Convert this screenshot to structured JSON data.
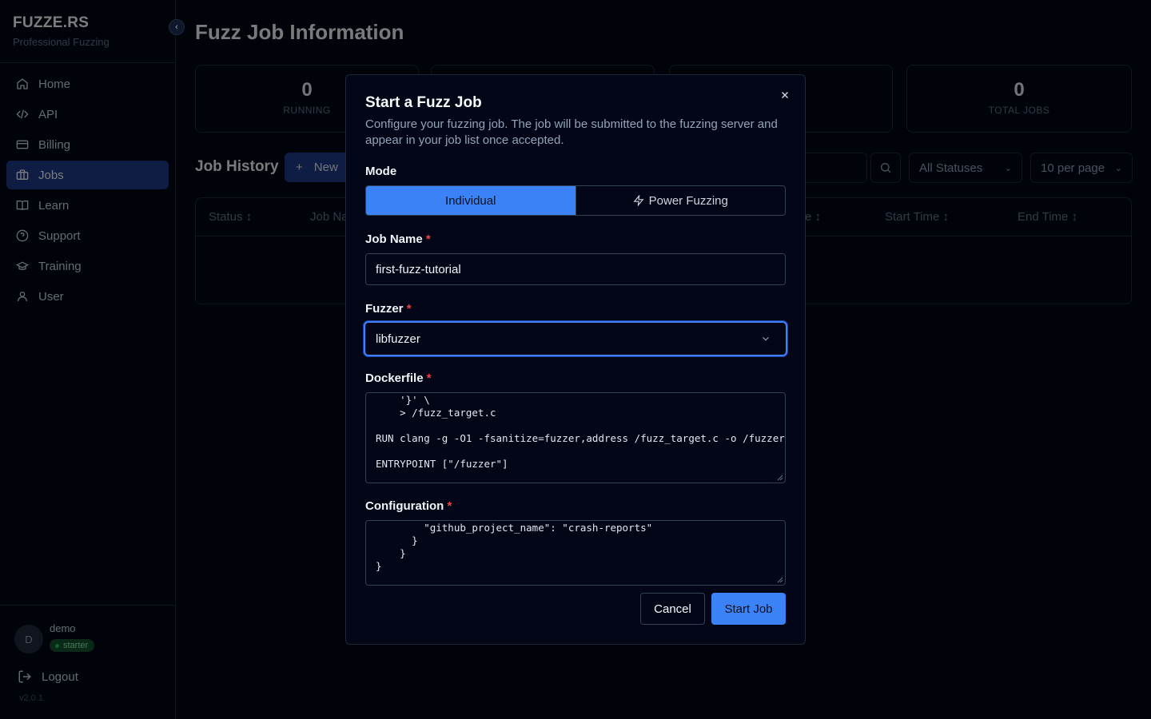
{
  "sidebar": {
    "brand_title": "FUZZE.RS",
    "brand_subtitle": "Professional Fuzzing",
    "items": [
      {
        "label": "Home",
        "icon": "home-icon",
        "active": false
      },
      {
        "label": "API",
        "icon": "code-icon",
        "active": false
      },
      {
        "label": "Billing",
        "icon": "credit-card-icon",
        "active": false
      },
      {
        "label": "Jobs",
        "icon": "briefcase-icon",
        "active": true
      },
      {
        "label": "Learn",
        "icon": "book-icon",
        "active": false
      },
      {
        "label": "Support",
        "icon": "help-circle-icon",
        "active": false
      },
      {
        "label": "Training",
        "icon": "graduation-cap-icon",
        "active": false
      },
      {
        "label": "User",
        "icon": "user-icon",
        "active": false
      }
    ],
    "user": {
      "avatar_initial": "D",
      "name": "demo",
      "plan": "starter"
    },
    "logout_label": "Logout",
    "version": "v2.0.1"
  },
  "main": {
    "title": "Fuzz Job Information",
    "stats": [
      {
        "value": "0",
        "label": "RUNNING"
      },
      {
        "value": "0",
        "label": "TOTAL JOBS"
      }
    ],
    "section_title": "Job History",
    "new_job_label": "New",
    "status_filter": "All Statuses",
    "per_page": "10 per page",
    "columns": [
      "Status",
      "Job Na",
      "e",
      "Start Time",
      "End Time"
    ]
  },
  "modal": {
    "title": "Start a Fuzz Job",
    "description": "Configure your fuzzing job. The job will be submitted to the fuzzing server and appear in your job list once accepted.",
    "mode_label": "Mode",
    "mode_options": [
      "Individual",
      "Power Fuzzing"
    ],
    "mode_selected": "Individual",
    "job_name_label": "Job Name",
    "job_name_value": "first-fuzz-tutorial",
    "fuzzer_label": "Fuzzer",
    "fuzzer_value": "libfuzzer",
    "dockerfile_label": "Dockerfile",
    "dockerfile_lines": [
      "    '}' \\",
      "    > /fuzz_target.c",
      "",
      "RUN clang -g -O1 -fsanitize=fuzzer,address /fuzz_target.c -o /fuzzer",
      "",
      "ENTRYPOINT [\"/fuzzer\"]"
    ],
    "configuration_label": "Configuration",
    "configuration_lines": [
      "        \"github_project_name\": \"crash-reports\"",
      "      }",
      "    }",
      "}"
    ],
    "required_marker": "*",
    "cancel_label": "Cancel",
    "start_label": "Start Job"
  },
  "colors": {
    "accent": "#3b82f6",
    "background": "#020617",
    "active_nav": "#1e3a8a",
    "required": "#ef4444"
  }
}
